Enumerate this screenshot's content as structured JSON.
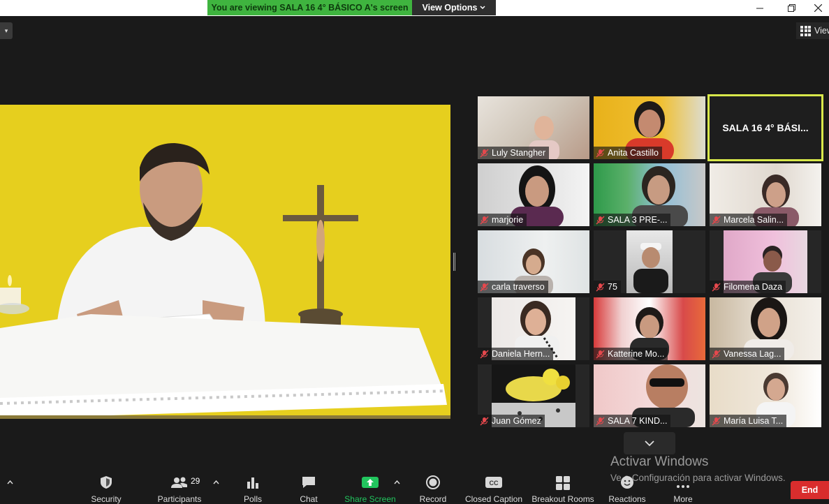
{
  "banner": {
    "message": "You are viewing SALA 16 4° BÁSICO A's screen",
    "view_options": "View Options"
  },
  "top_right_view": "View",
  "active_speaker": "SALA 16 4° BÁSI...",
  "participants": [
    {
      "name": "Luly Stangher"
    },
    {
      "name": "Anita Castillo"
    },
    {
      "name": "marjorie"
    },
    {
      "name": "SALA 3 PRE-..."
    },
    {
      "name": "Marcela Salin..."
    },
    {
      "name": "carla traverso"
    },
    {
      "name": "75"
    },
    {
      "name": "Filomena Daza"
    },
    {
      "name": "Daniela Hern..."
    },
    {
      "name": "Katterine Mo..."
    },
    {
      "name": "Vanessa Lag..."
    },
    {
      "name": "Juan Gómez"
    },
    {
      "name": "SALA 7 KIND..."
    },
    {
      "name": "María Luisa T..."
    }
  ],
  "watermark": {
    "line1": "Activar Windows",
    "line2": "Ve a Configuración para activar Windows."
  },
  "toolbar": {
    "security": "Security",
    "participants": "Participants",
    "participants_count": "29",
    "polls": "Polls",
    "chat": "Chat",
    "share_screen": "Share Screen",
    "record": "Record",
    "closed_caption": "Closed Caption",
    "breakout_rooms": "Breakout Rooms",
    "reactions": "Reactions",
    "more": "More",
    "end": "End"
  },
  "colors": {
    "banner_green": "#3fb43f",
    "active_border": "#d8e84a",
    "end_red": "#d92d2d",
    "share_green": "#22c55e",
    "muted_red": "#e5484d"
  }
}
